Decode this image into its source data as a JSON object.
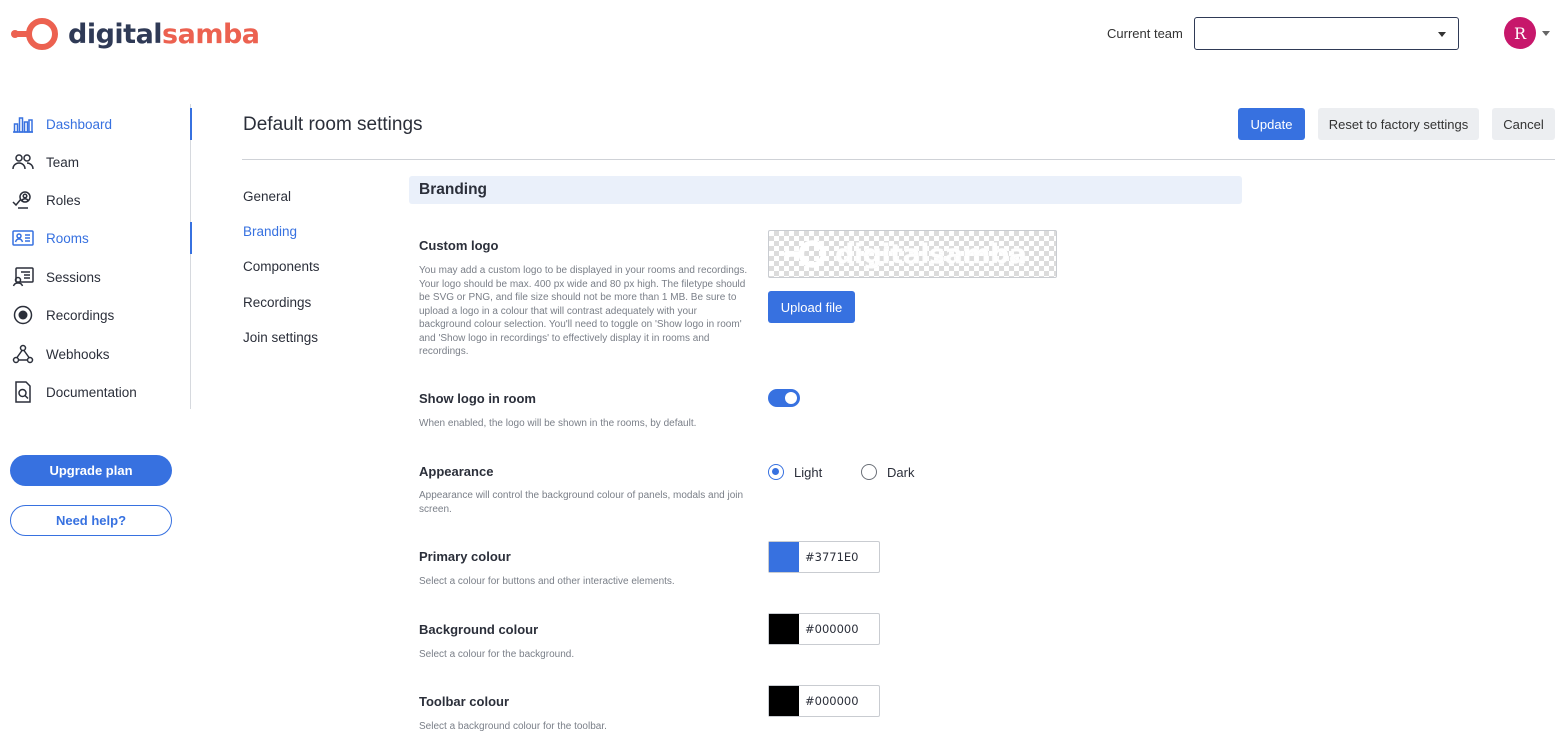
{
  "brand": {
    "part1": "digital",
    "part2": "samba",
    "accent": "#ec6150",
    "dark": "#2f3a56"
  },
  "header": {
    "team_label": "Current team",
    "team_value": "",
    "avatar_letter": "R",
    "avatar_color": "#c7176b"
  },
  "sidebar": {
    "items": [
      {
        "label": "Dashboard",
        "icon": "bar-chart-icon"
      },
      {
        "label": "Team",
        "icon": "users-icon"
      },
      {
        "label": "Roles",
        "icon": "roles-icon"
      },
      {
        "label": "Rooms",
        "icon": "rooms-icon"
      },
      {
        "label": "Sessions",
        "icon": "sessions-icon"
      },
      {
        "label": "Recordings",
        "icon": "record-icon"
      },
      {
        "label": "Webhooks",
        "icon": "webhooks-icon"
      },
      {
        "label": "Documentation",
        "icon": "documentation-icon"
      }
    ],
    "upgrade_label": "Upgrade plan",
    "help_label": "Need help?"
  },
  "page": {
    "title": "Default room settings",
    "update_label": "Update",
    "reset_label": "Reset to factory settings",
    "cancel_label": "Cancel"
  },
  "subnav": [
    "General",
    "Branding",
    "Components",
    "Recordings",
    "Join settings"
  ],
  "section": {
    "title": "Branding",
    "custom_logo": {
      "title": "Custom logo",
      "desc": "You may add a custom logo to be displayed in your rooms and recordings. Your logo should be max. 400 px wide and 80 px high. The filetype should be SVG or PNG, and file size should not be more than 1 MB. Be sure to upload a logo in a colour that will contrast adequately with your background colour selection. You'll need to toggle on 'Show logo in room' and 'Show logo in recordings' to effectively display it in rooms and recordings.",
      "upload_label": "Upload file"
    },
    "show_logo": {
      "title": "Show logo in room",
      "desc": "When enabled, the logo will be shown in the rooms, by default.",
      "enabled": true
    },
    "appearance": {
      "title": "Appearance",
      "desc": "Appearance will control the background colour of panels, modals and join screen.",
      "options": [
        "Light",
        "Dark"
      ],
      "selected": "Light"
    },
    "primary_colour": {
      "title": "Primary colour",
      "desc": "Select a colour for buttons and other interactive elements.",
      "value": "#3771E0"
    },
    "background_colour": {
      "title": "Background colour",
      "desc": "Select a colour for the background.",
      "value": "#000000"
    },
    "toolbar_colour": {
      "title": "Toolbar colour",
      "desc": "Select a background colour for the toolbar.",
      "value": "#000000"
    }
  }
}
